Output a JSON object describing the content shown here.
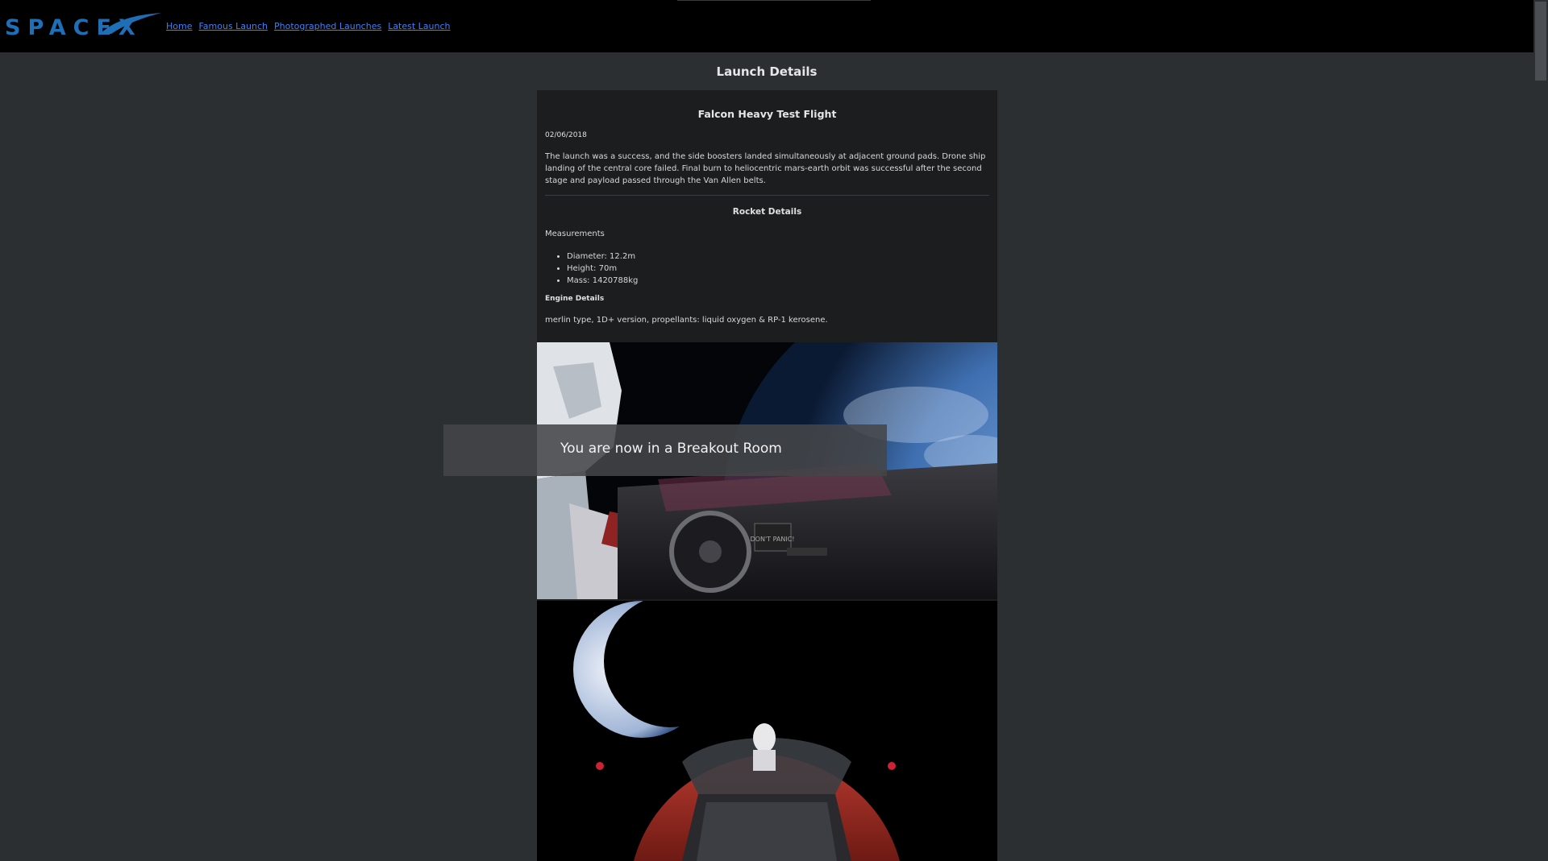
{
  "header": {
    "logo_text": "SPACEX",
    "nav": [
      "Home",
      "Famous Launch",
      "Photographed Launches",
      "Latest Launch"
    ]
  },
  "page": {
    "title": "Launch Details"
  },
  "launch": {
    "name": "Falcon Heavy Test Flight",
    "date": "02/06/2018",
    "details": "The launch was a success, and the side boosters landed simultaneously at adjacent ground pads. Drone ship landing of the central core failed. Final burn to heliocentric mars-earth orbit was successful after the second stage and payload passed through the Van Allen belts.",
    "rocket_title": "Rocket Details",
    "measurements_label": "Measurements",
    "measurements": [
      "Diameter: 12.2m",
      "Height: 70m",
      "Mass: 1420788kg"
    ],
    "engine_title": "Engine Details",
    "engine": "merlin type, 1D+ version, propellants: liquid oxygen & RP-1 kerosene."
  },
  "photo1": {
    "sign_text": "DON'T PANIC!"
  },
  "toast": {
    "message": "You are now in a Breakout Room"
  },
  "colors": {
    "background": "#2b2f31",
    "header": "#000000",
    "card": "#1b1d1f",
    "link": "#3b82f6",
    "logo": "#1f6fb6"
  }
}
